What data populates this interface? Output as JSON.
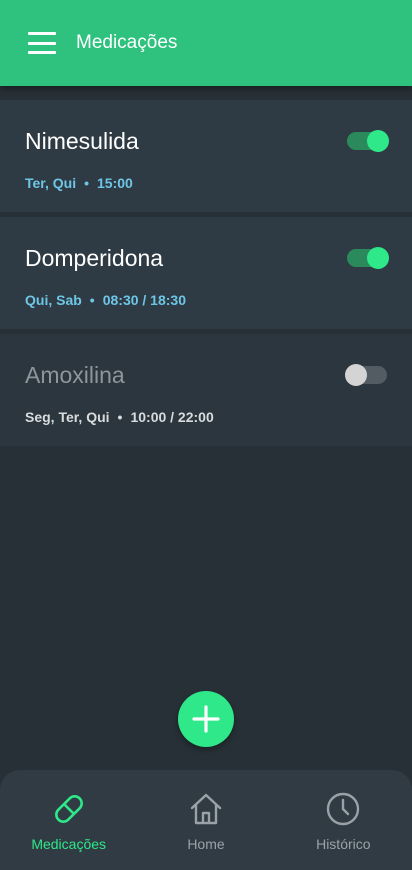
{
  "app": {
    "title": "Medicações"
  },
  "colors": {
    "primary": "#2ec27e",
    "accent": "#2ee88a",
    "schedule_active": "#6ec6e6"
  },
  "medications": [
    {
      "name": "Nimesulida",
      "days": "Ter, Qui",
      "times": "15:00",
      "enabled": true
    },
    {
      "name": "Domperidona",
      "days": "Qui, Sab",
      "times": "08:30 / 18:30",
      "enabled": true
    },
    {
      "name": "Amoxilina",
      "days": "Seg, Ter, Qui",
      "times": "10:00 / 22:00",
      "enabled": false
    }
  ],
  "separator": "•",
  "fab": {
    "icon": "plus-icon"
  },
  "bottom_nav": {
    "items": [
      {
        "label": "Medicações",
        "icon": "pill-icon",
        "active": true
      },
      {
        "label": "Home",
        "icon": "home-icon",
        "active": false
      },
      {
        "label": "Histórico",
        "icon": "clock-icon",
        "active": false
      }
    ]
  }
}
